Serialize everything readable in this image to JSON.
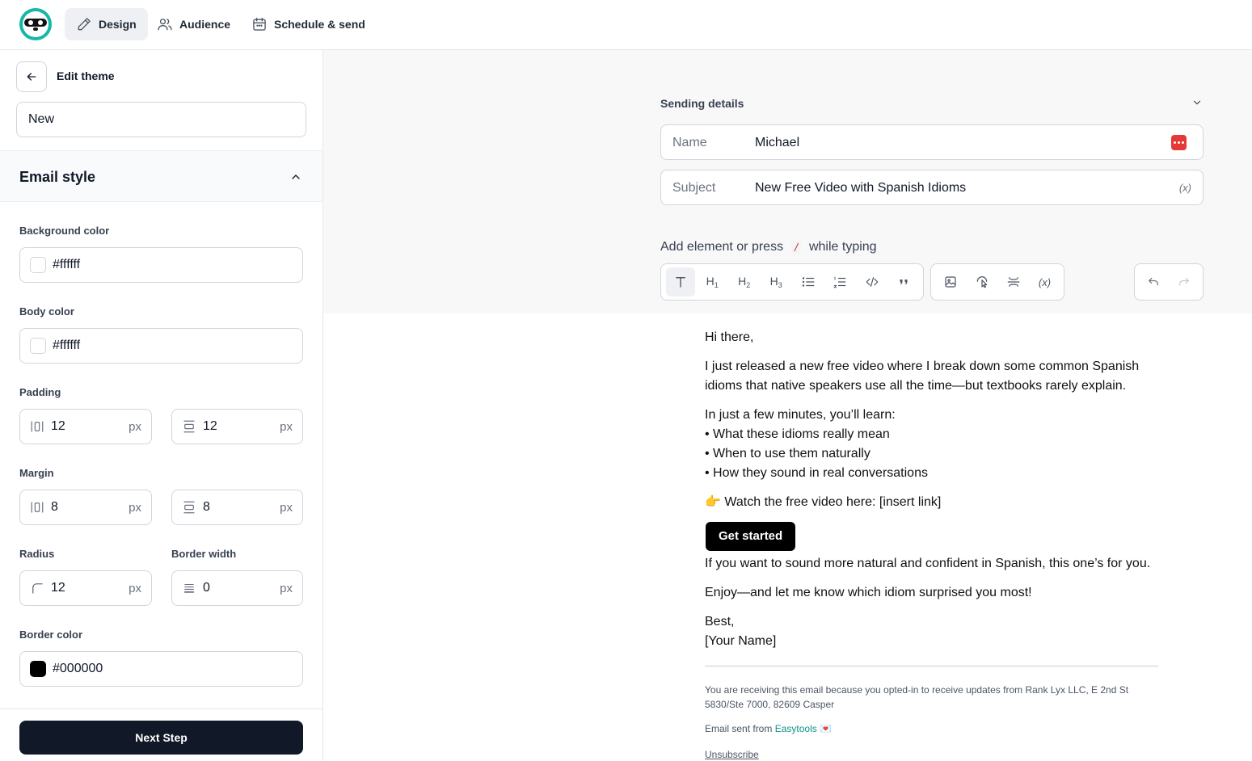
{
  "nav": {
    "tabs": [
      {
        "label": "Design",
        "icon": "pencil-icon",
        "active": true
      },
      {
        "label": "Audience",
        "icon": "users-icon",
        "active": false
      },
      {
        "label": "Schedule & send",
        "icon": "calendar-icon",
        "active": false
      }
    ]
  },
  "sidebar": {
    "title": "Edit theme",
    "theme_name": "New",
    "section_title": "Email style",
    "background_color": {
      "label": "Background color",
      "value": "#ffffff"
    },
    "body_color": {
      "label": "Body color",
      "value": "#ffffff"
    },
    "padding": {
      "label": "Padding",
      "horizontal": "12",
      "vertical": "12",
      "unit": "px"
    },
    "margin": {
      "label": "Margin",
      "horizontal": "8",
      "vertical": "8",
      "unit": "px"
    },
    "radius": {
      "label": "Radius",
      "value": "12",
      "unit": "px"
    },
    "border_width": {
      "label": "Border width",
      "value": "0",
      "unit": "px"
    },
    "border_color": {
      "label": "Border color",
      "value": "#000000"
    },
    "next_button": "Next Step"
  },
  "sending": {
    "title": "Sending details",
    "name_label": "Name",
    "name_value": "Michael",
    "subject_label": "Subject",
    "subject_value": "New Free Video with Spanish Idioms",
    "variable_token": "(x)"
  },
  "editor": {
    "hint_before": "Add element or press",
    "hint_key": "/",
    "hint_after": "while typing",
    "tools": [
      "text-icon",
      "heading1-icon",
      "heading2-icon",
      "heading3-icon",
      "bullet-list-icon",
      "numbered-list-icon",
      "code-icon",
      "quote-icon",
      "image-icon",
      "button-icon",
      "divider-icon",
      "variable-icon",
      "undo-icon",
      "redo-icon"
    ]
  },
  "email": {
    "greeting": "Hi there,",
    "para1": "I just released a new free video where I break down some common Spanish idioms that native speakers use all the time—but textbooks rarely explain.",
    "learn_intro": "In just a few minutes, you’ll learn:",
    "bullet1": "• What these idioms really mean",
    "bullet2": "• When to use them naturally",
    "bullet3": "• How they sound in real conversations",
    "watch": "👉 Watch the free video here: [insert link]",
    "cta": "Get started",
    "para2": "If you want to sound more natural and confident in Spanish, this one’s for you.",
    "para3": "Enjoy—and let me know which idiom surprised you most!",
    "signoff": "Best,",
    "signature": "[Your Name]",
    "footer_notice": "You are receiving this email because you opted-in to receive updates from Rank Lyx LLC, E 2nd St 5830/Ste 7000, 82609 Casper",
    "footer_sent": "Email sent from",
    "footer_brand": "Easytools",
    "footer_heart": "💌",
    "unsubscribe": "Unsubscribe"
  },
  "colors": {
    "accent": "#14b8a6",
    "primary_button": "#111827",
    "danger": "#e53935"
  }
}
